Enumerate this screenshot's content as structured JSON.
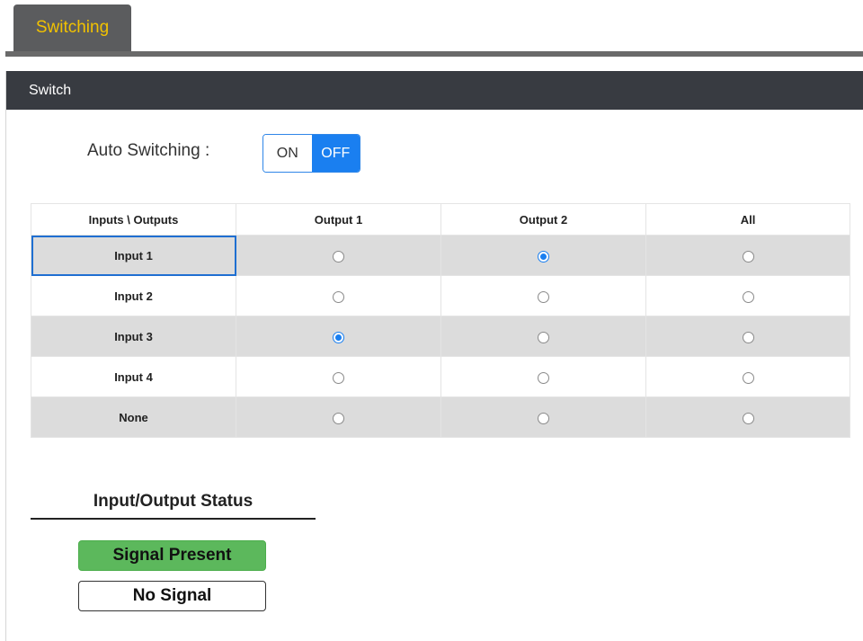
{
  "tabs": [
    {
      "label": "Switching"
    }
  ],
  "panel": {
    "title": "Switch"
  },
  "auto_switching": {
    "label": "Auto Switching :",
    "on_label": "ON",
    "off_label": "OFF",
    "selected": "OFF"
  },
  "matrix": {
    "headers": [
      "Inputs \\ Outputs",
      "Output 1",
      "Output 2",
      "All"
    ],
    "rows": [
      {
        "label": "Input 1",
        "selected": [
          false,
          true,
          false
        ]
      },
      {
        "label": "Input 2",
        "selected": [
          false,
          false,
          false
        ]
      },
      {
        "label": "Input 3",
        "selected": [
          true,
          false,
          false
        ]
      },
      {
        "label": "Input 4",
        "selected": [
          false,
          false,
          false
        ]
      },
      {
        "label": "None",
        "selected": [
          false,
          false,
          false
        ]
      }
    ]
  },
  "status": {
    "title": "Input/Output Status",
    "signal_present": "Signal Present",
    "no_signal": "No Signal"
  },
  "colors": {
    "tab_text": "#f2c200",
    "header_bg": "#383b41",
    "accent": "#1a7ff0",
    "signal_present": "#5cb85c"
  }
}
